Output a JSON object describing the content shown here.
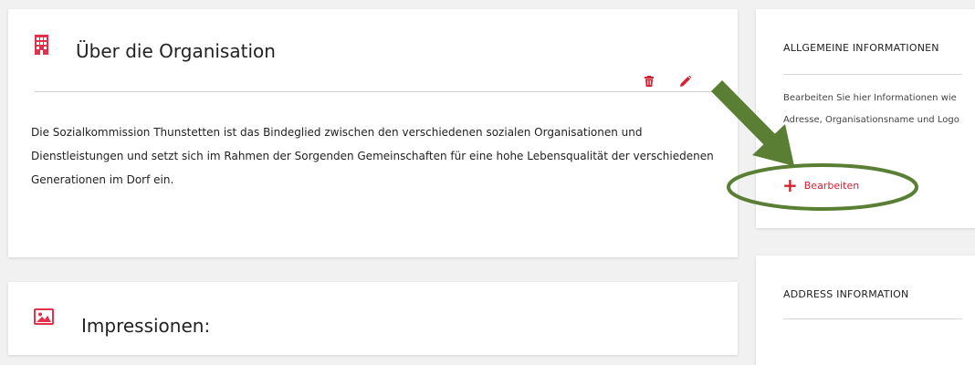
{
  "about": {
    "title": "Über die Organisation",
    "text": "Die Sozialkommission Thunstetten ist das Bindeglied zwischen den verschiedenen sozialen Organisationen und Dienstleistungen und setzt sich im Rahmen der Sorgenden Gemeinschaften für eine hohe Lebensqualität der verschiedenen Generationen im Dorf ein.",
    "icon": "building-icon",
    "actions": [
      "trash-icon",
      "pencil-icon"
    ]
  },
  "impressions": {
    "title": "Impressionen:",
    "icon": "image-icon"
  },
  "general_info": {
    "title": "ALLGEMEINE INFORMATIONEN",
    "text": "Bearbeiten Sie hier Informationen wie Adresse, Organisationsname und Logo",
    "edit_label": "Bearbeiten",
    "edit_icon": "plus-icon"
  },
  "address_info": {
    "title": "ADDRESS INFORMATION"
  },
  "colors": {
    "accent": "#d6202f",
    "annotation": "#5a7f34",
    "background": "#f1f1f1"
  }
}
